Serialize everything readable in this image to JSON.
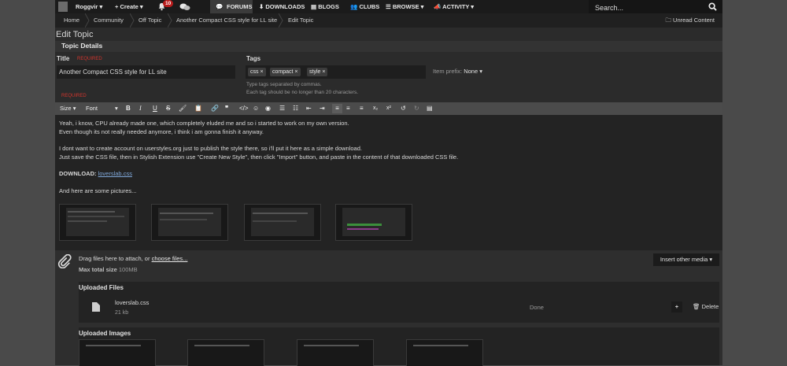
{
  "nav": {
    "user": "Roggvir",
    "create": "+ Create",
    "notif_count": "10",
    "forums": "FORUMS",
    "downloads": "DOWNLOADS",
    "blogs": "BLOGS",
    "clubs": "CLUBS",
    "browse": "BROWSE",
    "activity": "ACTIVITY",
    "search_placeholder": "Search..."
  },
  "breadcrumb": {
    "items": [
      "Home",
      "Community",
      "Off Topic",
      "Another Compact CSS style for LL site",
      "Edit Topic"
    ],
    "unread": "Unread Content"
  },
  "page_title": "Edit Topic",
  "section_title": "Topic Details",
  "form": {
    "title_label": "Title",
    "title_required": "REQUIRED",
    "title_value": "Another Compact CSS style for LL site",
    "title_required_below": "REQUIRED",
    "tags_label": "Tags",
    "tags": [
      "css",
      "compact",
      "style"
    ],
    "tag_remove": "×",
    "tag_hint1": "Type tags separated by commas.",
    "tag_hint2": "Each tag should be no longer than 20 characters.",
    "prefix_label": "Item prefix:",
    "prefix_value": "None"
  },
  "toolbar": {
    "size": "Size",
    "font": "Font"
  },
  "content": {
    "line1": "Yeah, i know, CPU already made one, which completely eluded me and so i started to work on my own version.",
    "line2": "Even though its not really needed anymore, i think i am gonna finish it anyway.",
    "line3": "I dont want to create account on userstyles.org just to publish the style there, so i'll put it here as a simple download.",
    "line4": "Just save the CSS file, then in Stylish Extension use \"Create New Style\", then click \"Import\" button, and paste in the content of that downloaded CSS file.",
    "download_label": "DOWNLOAD:",
    "download_link": "loverslab.css",
    "pictures": "And here are some pictures..."
  },
  "attach": {
    "drag_text": "Drag files here to attach, or",
    "choose": "choose files...",
    "max_label": "Max total size",
    "max_value": "100MB",
    "insert_media": "Insert other media",
    "uploaded_files": "Uploaded Files",
    "file_name": "loverslab.css",
    "file_size": "21 kb",
    "file_status": "Done",
    "delete": "Delete",
    "uploaded_images": "Uploaded Images"
  }
}
